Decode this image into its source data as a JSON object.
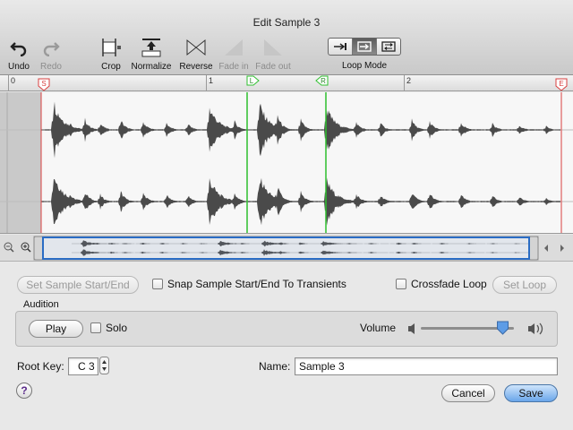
{
  "window": {
    "title": "Edit Sample 3"
  },
  "toolbar": {
    "undo": "Undo",
    "redo": "Redo",
    "crop": "Crop",
    "normalize": "Normalize",
    "reverse": "Reverse",
    "fade_in": "Fade in",
    "fade_out": "Fade out",
    "loop_mode": "Loop Mode"
  },
  "ruler": {
    "labels": [
      "0",
      "1",
      "2"
    ],
    "markers": {
      "start": "S",
      "end": "E",
      "loop_left": "L",
      "loop_right": "R"
    }
  },
  "controls": {
    "set_sample_start_end": "Set Sample Start/End",
    "snap_transients": "Snap Sample Start/End To Transients",
    "crossfade_loop": "Crossfade Loop",
    "set_loop": "Set Loop",
    "audition": "Audition",
    "play": "Play",
    "solo": "Solo",
    "volume": "Volume",
    "volume_level": 0.88,
    "root_key_label": "Root Key:",
    "root_key_value": "C 3",
    "name_label": "Name:",
    "name_value": "Sample 3",
    "cancel": "Cancel",
    "save": "Save",
    "help": "?"
  },
  "colors": {
    "waveform": "#4a4a4a",
    "loop_marker": "#2fbf2f",
    "range_marker": "#d94040",
    "accent": "#2a6cc4"
  }
}
